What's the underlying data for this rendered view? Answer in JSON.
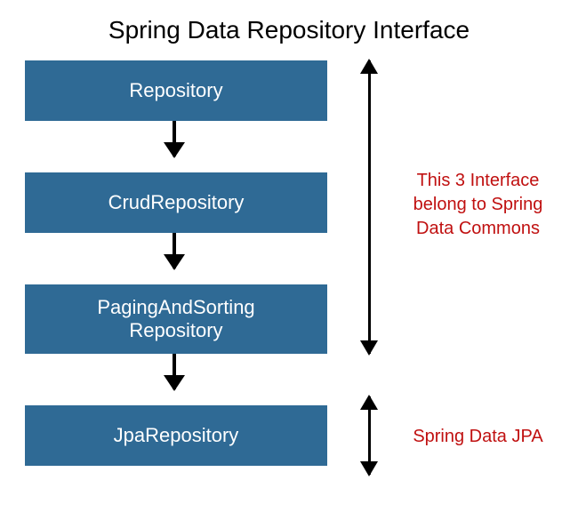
{
  "title": "Spring Data Repository Interface",
  "boxes": {
    "repository": "Repository",
    "crud": "CrudRepository",
    "paging_line1": "PagingAndSorting",
    "paging_line2": "Repository",
    "jpa": "JpaRepository"
  },
  "annotations": {
    "commons_line1": "This 3 Interface",
    "commons_line2": "belong to Spring",
    "commons_line3": "Data Commons",
    "jpa": "Spring Data JPA"
  },
  "colors": {
    "box_bg": "#2f6a95",
    "box_text": "#ffffff",
    "annotation_text": "#c01010",
    "arrow": "#000000"
  }
}
